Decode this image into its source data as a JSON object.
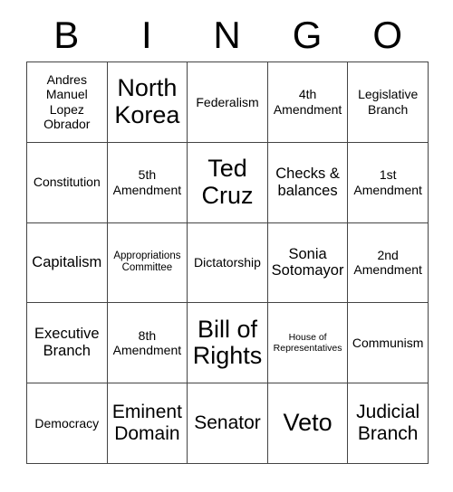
{
  "card": {
    "title": "BINGO",
    "header_letters": [
      "B",
      "I",
      "N",
      "G",
      "O"
    ],
    "grid_line_color": "#444444",
    "text_color": "#000000",
    "background_color": "#ffffff",
    "rows": [
      [
        {
          "label": "Andres Manuel Lopez Obrador",
          "size": "md"
        },
        {
          "label": "North Korea",
          "size": "xxl"
        },
        {
          "label": "Federalism",
          "size": "md"
        },
        {
          "label": "4th Amendment",
          "size": "md"
        },
        {
          "label": "Legislative Branch",
          "size": "md"
        }
      ],
      [
        {
          "label": "Constitution",
          "size": "md"
        },
        {
          "label": "5th Amendment",
          "size": "md"
        },
        {
          "label": "Ted Cruz",
          "size": "xxl"
        },
        {
          "label": "Checks & balances",
          "size": "lg"
        },
        {
          "label": "1st Amendment",
          "size": "md"
        }
      ],
      [
        {
          "label": "Capitalism",
          "size": "lg"
        },
        {
          "label": "Appropriations Committee",
          "size": "sm"
        },
        {
          "label": "Dictatorship",
          "size": "md"
        },
        {
          "label": "Sonia Sotomayor",
          "size": "lg"
        },
        {
          "label": "2nd Amendment",
          "size": "md"
        }
      ],
      [
        {
          "label": "Executive Branch",
          "size": "lg"
        },
        {
          "label": "8th Amendment",
          "size": "md"
        },
        {
          "label": "Bill of Rights",
          "size": "xxl"
        },
        {
          "label": "House of Representatives",
          "size": "xs"
        },
        {
          "label": "Communism",
          "size": "md"
        }
      ],
      [
        {
          "label": "Democracy",
          "size": "md"
        },
        {
          "label": "Eminent Domain",
          "size": "xl"
        },
        {
          "label": "Senator",
          "size": "xl"
        },
        {
          "label": "Veto",
          "size": "xxl"
        },
        {
          "label": "Judicial Branch",
          "size": "xl"
        }
      ]
    ]
  }
}
